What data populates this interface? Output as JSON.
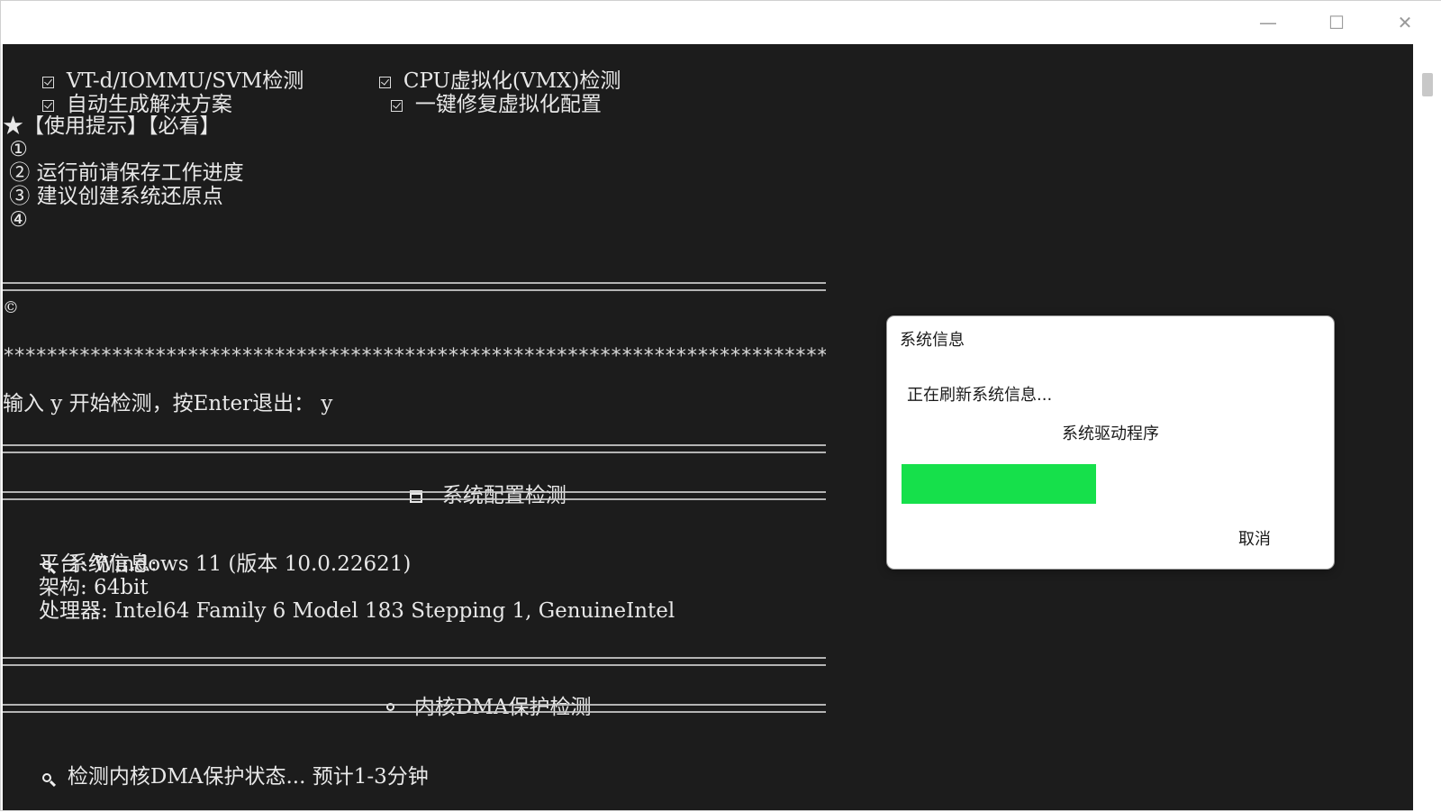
{
  "window": {
    "minimize_glyph": "—",
    "maximize_glyph": "☐",
    "close_glyph": "✕"
  },
  "console": {
    "features": {
      "item1": "VT-d/IOMMU/SVM检测",
      "item2": "CPU虚拟化(VMX)检测",
      "item3": "自动生成解决方案",
      "item4": "一键修复虚拟化配置"
    },
    "tips": {
      "header": "★【使用提示】【必看】",
      "tip1": " ①",
      "tip2": " ② 运行前请保存工作进度",
      "tip3": " ③ 建议创建系统还原点",
      "tip4": " ④"
    },
    "copyright": "©",
    "stars": "****************************************************************************",
    "prompt": "输入 y 开始检测，按Enter退出： y",
    "section1_title": "系统配置检测",
    "sysinfo": {
      "label": "系统信息:",
      "platform": "平台: Windows 11 (版本 10.0.22621)",
      "arch": "架构: 64bit",
      "cpu": "处理器: Intel64 Family 6 Model 183 Stepping 1, GenuineIntel"
    },
    "section2_title": "内核DMA保护检测",
    "dma_status": "检测内核DMA保护状态... 预计1-3分钟"
  },
  "dialog": {
    "title": "系统信息",
    "message": "正在刷新系统信息...",
    "subtext": "系统驱动程序",
    "progress_fraction": 0.47,
    "progress_color": "#16e04b",
    "cancel_label": "取消"
  }
}
